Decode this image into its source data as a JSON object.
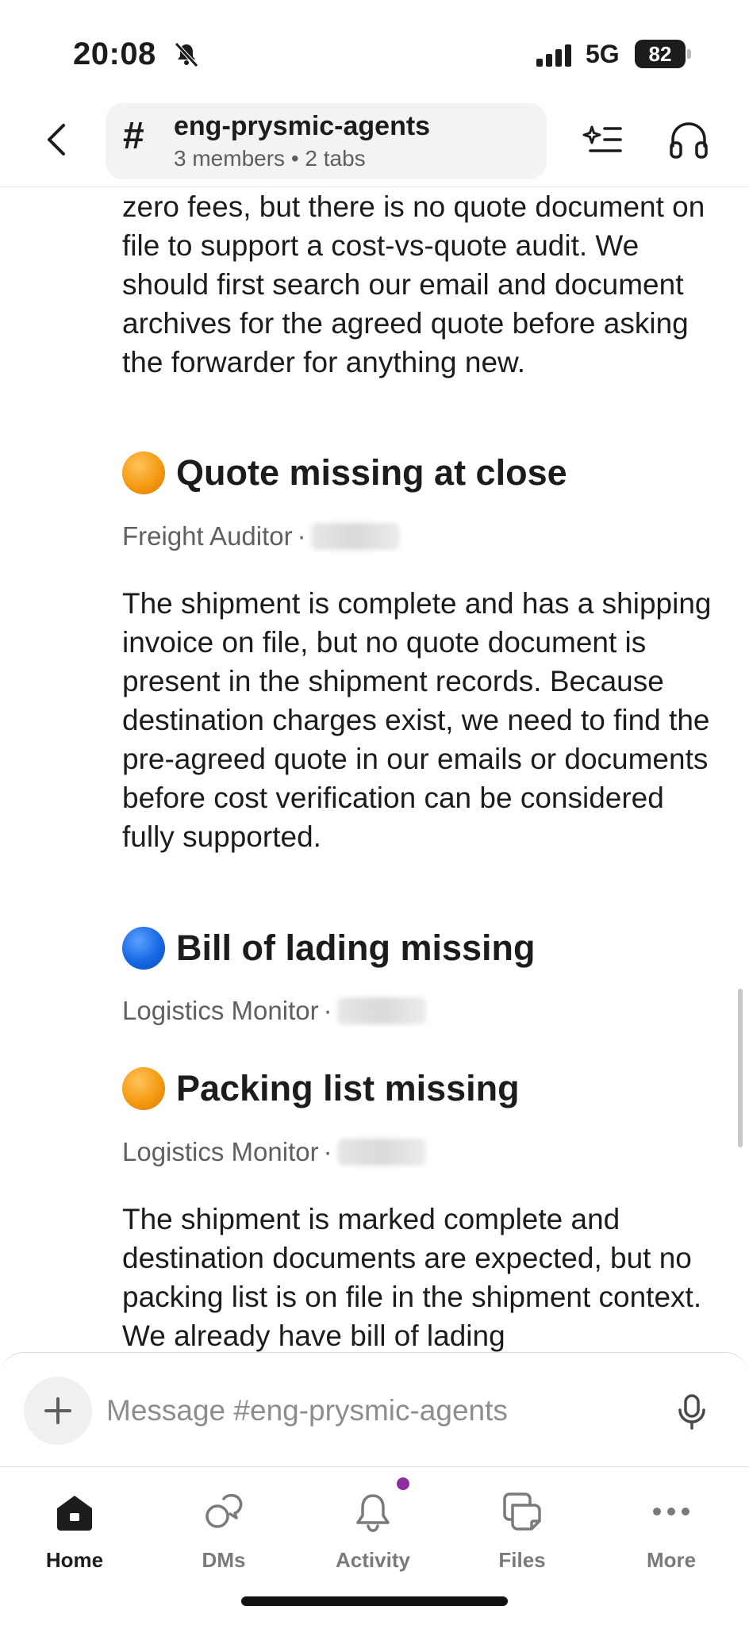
{
  "status_bar": {
    "time": "20:08",
    "network": "5G",
    "battery": "82"
  },
  "header": {
    "channel_name": "eng-prysmic-agents",
    "channel_meta": "3 members • 2 tabs",
    "hash": "#"
  },
  "messages": {
    "intro_text": "zero fees, but there is no quote document on file to support a cost-vs-quote audit. We should first search our email and document archives for the agreed quote before asking the forwarder for anything new.",
    "items": [
      {
        "status_color": "orange",
        "title": "Quote missing at close",
        "author": "Freight Auditor",
        "body": "The shipment is complete and has a shipping invoice on file, but no quote document is present in the shipment records. Because destination charges exist, we need to find the pre-agreed quote in our emails or documents before cost verification can be considered fully supported."
      },
      {
        "status_color": "blue",
        "title": "Bill of lading missing",
        "author": "Logistics Monitor",
        "body": ""
      },
      {
        "status_color": "orange",
        "title": "Packing list missing",
        "author": "Logistics Monitor",
        "body": "The shipment is marked complete and destination documents are expected, but no packing list is on file in the shipment context. We already have bill of lading"
      }
    ],
    "meta_separator": "·"
  },
  "composer": {
    "placeholder": "Message #eng-prysmic-agents"
  },
  "tabbar": {
    "tabs": [
      {
        "label": "Home",
        "icon": "home-icon"
      },
      {
        "label": "DMs",
        "icon": "dms-icon"
      },
      {
        "label": "Activity",
        "icon": "bell-icon"
      },
      {
        "label": "Files",
        "icon": "files-icon"
      },
      {
        "label": "More",
        "icon": "more-icon"
      }
    ]
  },
  "colors": {
    "activity_badge": "#8b2fa0",
    "status_orange": "#f59a12",
    "status_blue": "#1668e3"
  }
}
